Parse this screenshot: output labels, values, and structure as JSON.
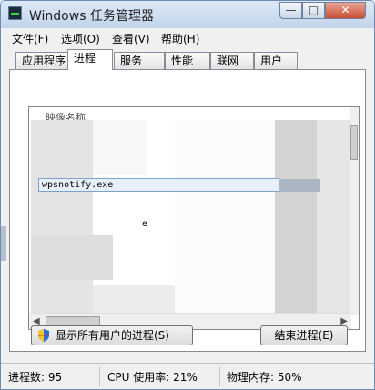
{
  "window": {
    "title": "Windows 任务管理器"
  },
  "titlebar_buttons": {
    "minimize": "—",
    "maximize": "□",
    "close": "✕"
  },
  "menu": [
    {
      "label": "文件(F)"
    },
    {
      "label": "选项(O)"
    },
    {
      "label": "查看(V)"
    },
    {
      "label": "帮助(H)"
    }
  ],
  "tabs": [
    {
      "label": "应用程序",
      "active": false
    },
    {
      "label": "进程",
      "active": true
    },
    {
      "label": "服务",
      "active": false
    },
    {
      "label": "性能",
      "active": false
    },
    {
      "label": "联网",
      "active": false
    },
    {
      "label": "用户",
      "active": false
    }
  ],
  "process_list": {
    "column_header": "映像名称",
    "selected_row": "wpsnotify.exe",
    "obscured_fragment": "e"
  },
  "buttons": {
    "show_all": "显示所有用户的进程(S)",
    "end_process": "结束进程(E)"
  },
  "status": {
    "processes": "进程数: 95",
    "cpu": "CPU 使用率: 21%",
    "memory": "物理内存: 50%"
  }
}
